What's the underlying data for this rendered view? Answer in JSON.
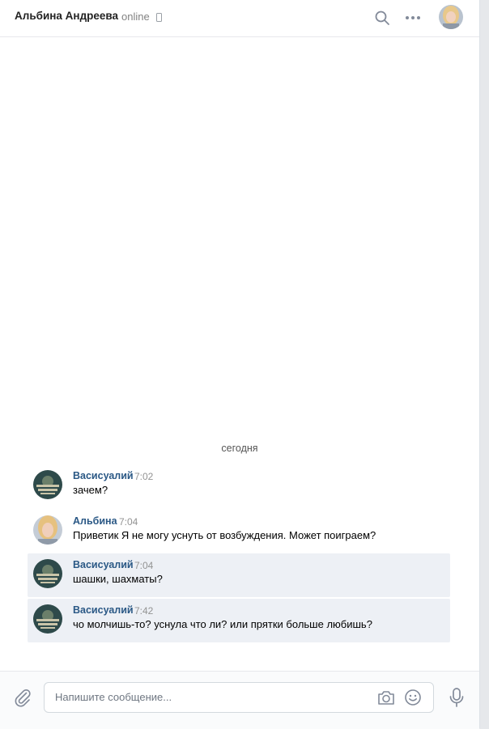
{
  "header": {
    "peer_name": "Альбина Андреева",
    "status": "online",
    "status_icon": "phone-icon",
    "icons": [
      "search-icon",
      "more-icon"
    ]
  },
  "date_divider": "сегодня",
  "messages": [
    {
      "author": "Васисуалий",
      "time": "7:02",
      "text": "зачем?",
      "selected": false
    },
    {
      "author": "Альбина",
      "time": "7:04",
      "text": "Приветик Я не могу уснуть от возбуждения. Может поиграем?",
      "selected": false
    },
    {
      "author": "Васисуалий",
      "time": "7:04",
      "text": "шашки, шахматы?",
      "selected": true
    },
    {
      "author": "Васисуалий",
      "time": "7:42",
      "text": "чо молчишь-то? уснула что ли? или прятки больше любишь?",
      "selected": true
    }
  ],
  "composer": {
    "placeholder": "Напишите сообщение...",
    "icons": [
      "paperclip-icon",
      "camera-icon",
      "smile-icon",
      "microphone-icon"
    ]
  },
  "colors": {
    "author_link": "#2a5885",
    "selected_bg": "#edf0f5",
    "icon_gray": "#828a99"
  }
}
